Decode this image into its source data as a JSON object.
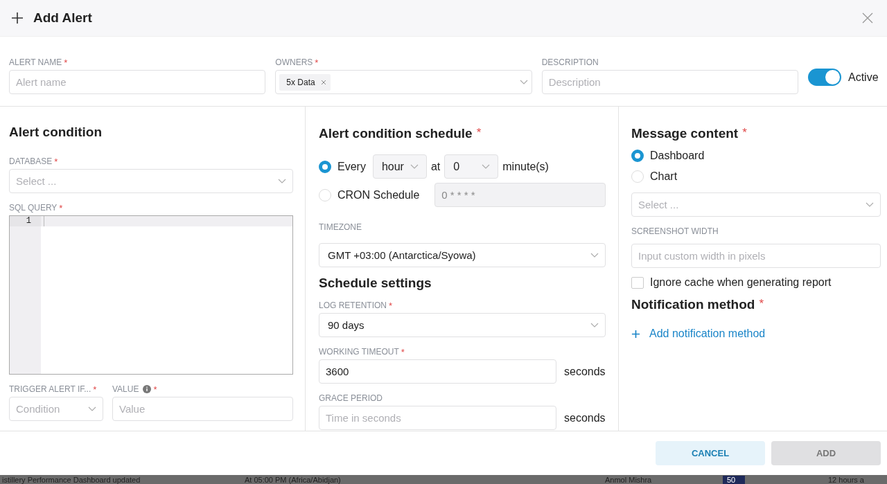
{
  "header": {
    "title": "Add Alert"
  },
  "top_fields": [
    {
      "label": "ALERT NAME",
      "required_mark": "*",
      "kind": "input",
      "placeholder": "Alert name"
    },
    {
      "label": "OWNERS",
      "required_mark": "*",
      "kind": "tags",
      "tags": [
        "5x Data"
      ]
    },
    {
      "label": "DESCRIPTION",
      "kind": "input",
      "placeholder": "Description"
    }
  ],
  "active_toggle": {
    "label": "Active",
    "on": true
  },
  "alert_condition": {
    "title": "Alert condition",
    "database": {
      "label": "DATABASE",
      "required_mark": "*",
      "placeholder": "Select ..."
    },
    "sql_query": {
      "label": "SQL QUERY",
      "required_mark": "*",
      "line_numbers": [
        "1"
      ]
    },
    "trigger": {
      "label": "TRIGGER ALERT IF...",
      "required_mark": "*",
      "placeholder": "Condition"
    },
    "value": {
      "label": "VALUE",
      "required_mark": "*",
      "placeholder": "Value"
    }
  },
  "schedule": {
    "title": "Alert condition schedule",
    "required_mark": "*",
    "every": {
      "selected": true,
      "label": "Every",
      "unit": "hour",
      "at": "at",
      "minute": "0",
      "suffix": "minute(s)"
    },
    "cron": {
      "selected": false,
      "label": "CRON Schedule",
      "value": "0 * * * *",
      "disabled": true
    },
    "timezone": {
      "label": "TIMEZONE",
      "value": "GMT +03:00 (Antarctica/Syowa)"
    }
  },
  "schedule_settings": {
    "title": "Schedule settings",
    "fields": [
      {
        "label": "LOG RETENTION",
        "required_mark": "*",
        "kind": "select",
        "value": "90 days"
      },
      {
        "label": "WORKING TIMEOUT",
        "required_mark": "*",
        "kind": "input",
        "value": "3600",
        "suffix": "seconds"
      },
      {
        "label": "GRACE PERIOD",
        "kind": "input",
        "placeholder": "Time in seconds",
        "suffix": "seconds"
      }
    ]
  },
  "message_content": {
    "title": "Message content",
    "required_mark": "*",
    "options": [
      {
        "label": "Dashboard",
        "selected": true
      },
      {
        "label": "Chart",
        "selected": false
      }
    ],
    "select": {
      "placeholder": "Select ..."
    },
    "screenshot_width": {
      "label": "SCREENSHOT WIDTH",
      "placeholder": "Input custom width in pixels"
    },
    "ignore_cache": {
      "label": "Ignore cache when generating report",
      "checked": false
    }
  },
  "notification_method": {
    "title": "Notification method",
    "required_mark": "*",
    "add_link": "Add notification method"
  },
  "footer": {
    "buttons": [
      {
        "label": "CANCEL",
        "kind": "secondary",
        "disabled": false
      },
      {
        "label": "ADD",
        "kind": "primary",
        "disabled": true
      }
    ]
  },
  "background_row": {
    "name": "istillery Performance Dashboard updated",
    "schedule": "At 05:00 PM (Africa/Abidjan)",
    "owner": "Anmol Mishra",
    "badge": "50",
    "time": "12 hours a"
  }
}
